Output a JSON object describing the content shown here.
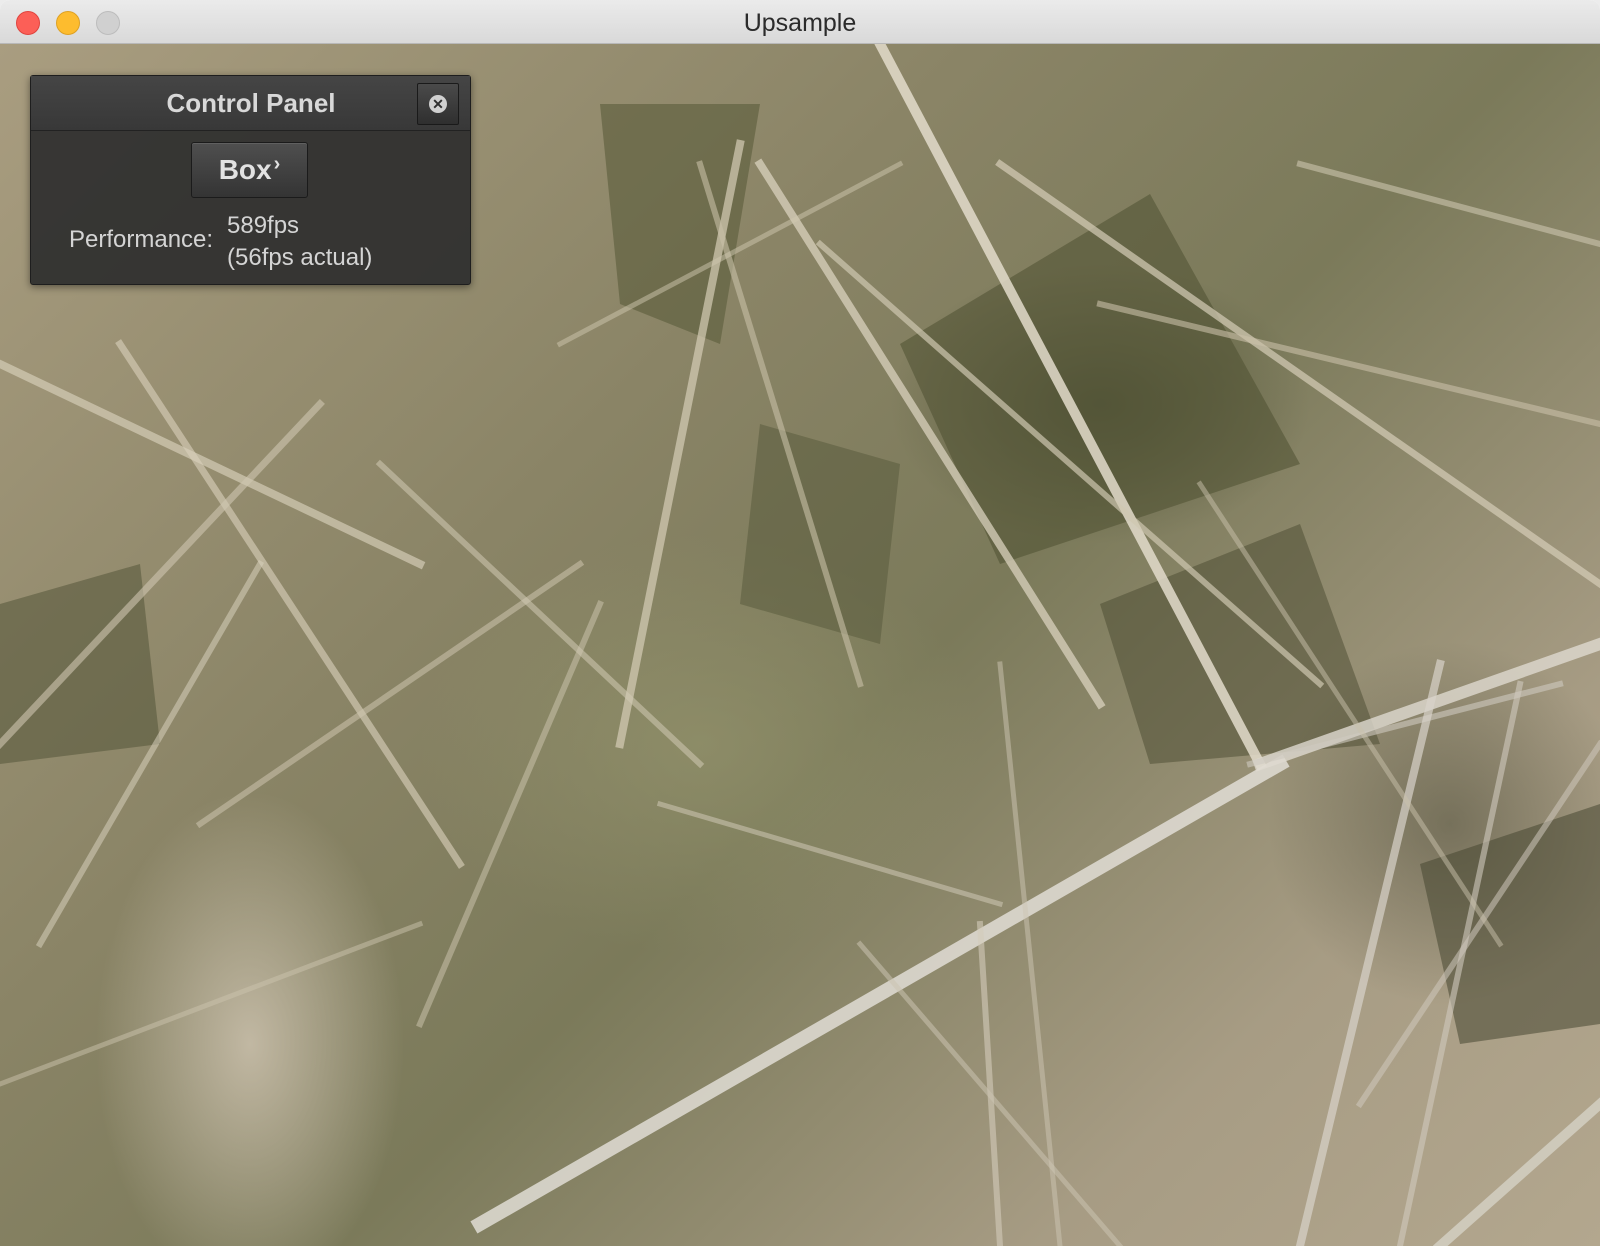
{
  "window": {
    "title": "Upsample"
  },
  "control_panel": {
    "title": "Control Panel",
    "mode_button_label": "Box",
    "mode_button_icon": "chevron-right-icon",
    "close_icon": "close-circle-icon",
    "performance_label": "Performance:",
    "performance_fps": "589fps",
    "performance_actual": "(56fps actual)"
  },
  "colors": {
    "close": "#fc5f57",
    "minimize": "#fdbc2e",
    "zoom_inactive": "#d0d0d0",
    "panel_bg": "#2e2e2e"
  }
}
